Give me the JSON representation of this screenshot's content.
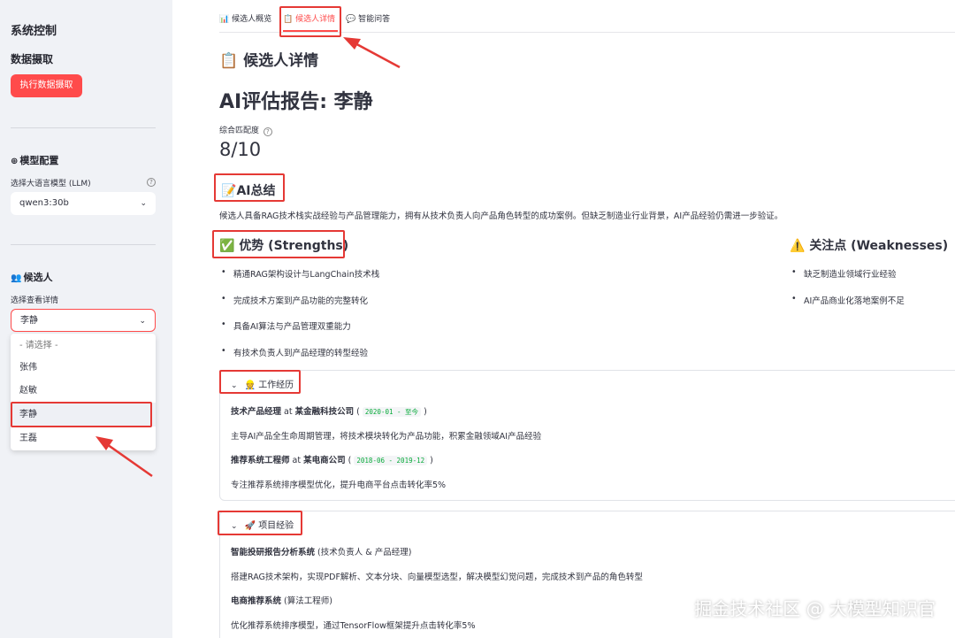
{
  "sidebar": {
    "title": "系统控制",
    "data_section": "数据摄取",
    "fetch_button": "执行数据摄取",
    "model_section": "模型配置",
    "model_label": "选择大语言模型 (LLM)",
    "model_value": "qwen3:30b",
    "candidate_section": "候选人",
    "candidate_label": "选择查看详情",
    "candidate_value": "李静",
    "dropdown_options": [
      "- 请选择 -",
      "张伟",
      "赵敏",
      "李静",
      "王磊"
    ]
  },
  "tabs": [
    {
      "label": "候选人概览",
      "icon": "bar-chart-icon"
    },
    {
      "label": "候选人详情",
      "icon": "clipboard-icon"
    },
    {
      "label": "智能问答",
      "icon": "speech-bubble-icon"
    }
  ],
  "main": {
    "page_title": "候选人详情",
    "report_title": "AI评估报告: 李静",
    "metric_label": "综合匹配度",
    "metric_value": "8/10",
    "summary_heading": "AI总结",
    "summary_text": "候选人具备RAG技术栈实战经验与产品管理能力，拥有从技术负责人向产品角色转型的成功案例。但缺乏制造业行业背景，AI产品经验仍需进一步验证。",
    "strengths_heading": "优势 (Strengths)",
    "strengths": [
      "精通RAG架构设计与LangChain技术栈",
      "完成技术方案到产品功能的完整转化",
      "具备AI算法与产品管理双重能力",
      "有技术负责人到产品经理的转型经验"
    ],
    "weaknesses_heading": "关注点 (Weaknesses)",
    "weaknesses": [
      "缺乏制造业领域行业经验",
      "AI产品商业化落地案例不足"
    ],
    "work_heading": "工作经历",
    "work": [
      {
        "title": "技术产品经理",
        "at": "at",
        "company": "某金融科技公司",
        "period": "2020-01 - 至今",
        "desc": "主导AI产品全生命周期管理，将技术模块转化为产品功能，积累金融领域AI产品经验"
      },
      {
        "title": "推荐系统工程师",
        "at": "at",
        "company": "某电商公司",
        "period": "2018-06 - 2019-12",
        "desc": "专注推荐系统排序模型优化，提升电商平台点击转化率5%"
      }
    ],
    "project_heading": "项目经验",
    "projects": [
      {
        "name": "智能投研报告分析系统",
        "role": "(技术负责人 & 产品经理)",
        "desc": "搭建RAG技术架构，实现PDF解析、文本分块、向量模型选型，解决模型幻觉问题，完成技术到产品的角色转型"
      },
      {
        "name": "电商推荐系统",
        "role": "(算法工程师)",
        "desc": "优化推荐系统排序模型，通过TensorFlow框架提升点击转化率5%"
      }
    ]
  },
  "watermark": "掘金技术社区 @ 大模型知识官",
  "colors": {
    "accent": "#ff4b4b",
    "annotation": "#e53935",
    "sidebar_bg": "#f0f2f6",
    "code_green": "#09ab3b"
  }
}
